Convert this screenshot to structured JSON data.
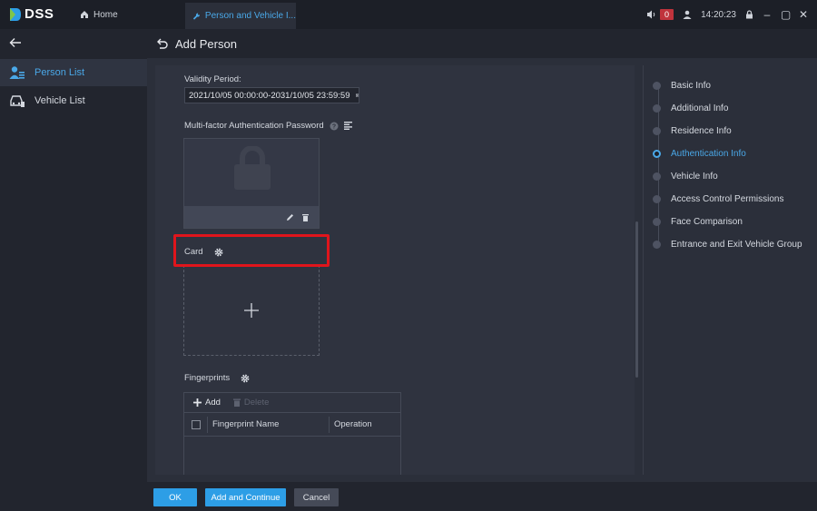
{
  "topbar": {
    "brand": "DSS",
    "home_tab": "Home",
    "active_tab": "Person and Vehicle I...",
    "alarm_count": "0",
    "time": "14:20:23"
  },
  "leftnav": {
    "items": [
      {
        "label": "Person List",
        "icon": "person-list-icon"
      },
      {
        "label": "Vehicle List",
        "icon": "vehicle-list-icon"
      }
    ]
  },
  "page": {
    "title": "Add Person"
  },
  "form": {
    "validity_label": "Validity Period:",
    "validity_value": "2021/10/05 00:00:00-2031/10/05 23:59:59",
    "mfa_label": "Multi-factor Authentication Password",
    "card_label": "Card",
    "fingerprints_label": "Fingerprints",
    "fp_add": "Add",
    "fp_delete": "Delete",
    "fp_columns": [
      "Fingerprint Name",
      "Operation"
    ]
  },
  "steps": [
    {
      "label": "Basic Info"
    },
    {
      "label": "Additional Info"
    },
    {
      "label": "Residence Info"
    },
    {
      "label": "Authentication Info",
      "active": true
    },
    {
      "label": "Vehicle Info"
    },
    {
      "label": "Access Control Permissions"
    },
    {
      "label": "Face Comparison"
    },
    {
      "label": "Entrance and Exit Vehicle Group"
    }
  ],
  "footer": {
    "ok": "OK",
    "add_continue": "Add and Continue",
    "cancel": "Cancel"
  },
  "colors": {
    "accent": "#2d9ee6",
    "highlight": "#e0151c"
  }
}
